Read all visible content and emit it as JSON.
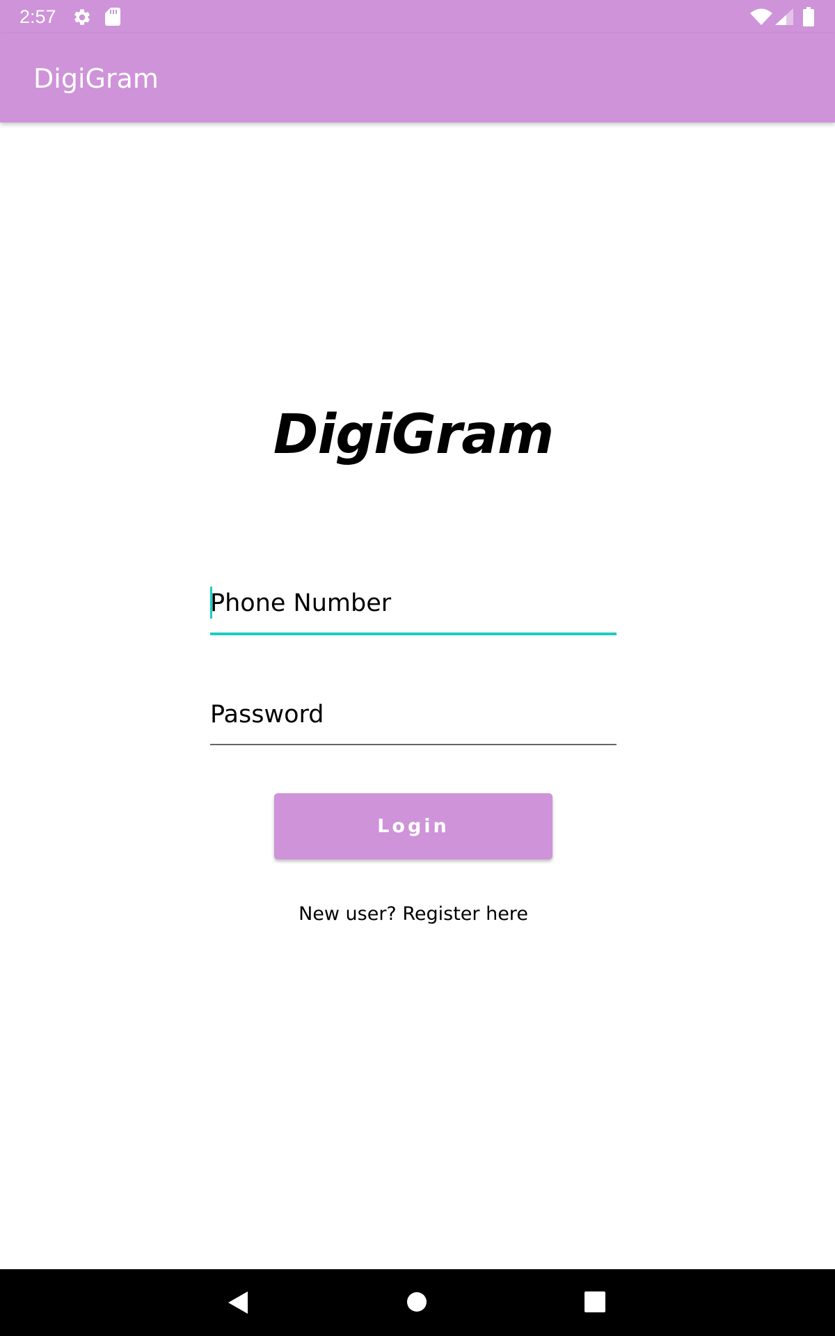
{
  "status_bar": {
    "time": "2:57",
    "icons": [
      "gear-icon",
      "sd-card-icon",
      "wifi-icon",
      "cell-signal-icon",
      "battery-icon"
    ]
  },
  "app_bar": {
    "title": "DigiGram"
  },
  "logo": {
    "text": "DigiGram"
  },
  "login_form": {
    "phone": {
      "placeholder": "Phone Number",
      "value": ""
    },
    "password": {
      "placeholder": "Password",
      "value": ""
    },
    "login_label": "Login",
    "register_label": "New user? Register here"
  },
  "nav_bar": {
    "buttons": [
      "back-icon",
      "home-icon",
      "recents-icon"
    ]
  },
  "colors": {
    "primary": "#CE93D8",
    "accent": "#1CCDC0",
    "text": "#000000",
    "nav_background": "#000000"
  }
}
